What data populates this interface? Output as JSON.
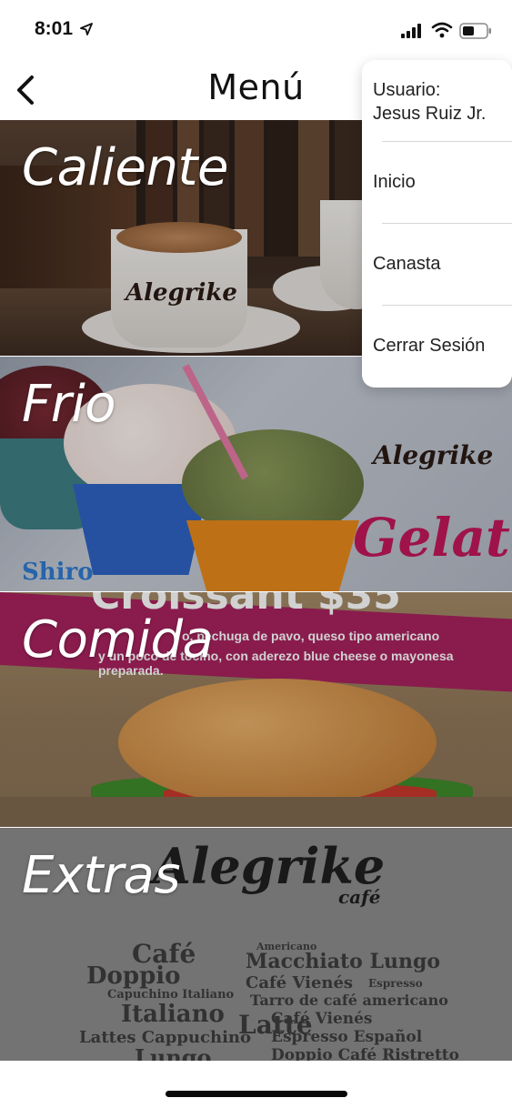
{
  "status_bar": {
    "time": "8:01",
    "icons": [
      "location-arrow-icon",
      "cellular-signal-icon",
      "wifi-icon",
      "battery-icon"
    ]
  },
  "nav": {
    "title": "Menú",
    "back_icon": "chevron-left-icon"
  },
  "categories": [
    {
      "label": "Caliente"
    },
    {
      "label": "Frio"
    },
    {
      "label": "Comida"
    },
    {
      "label": "Extras"
    }
  ],
  "image_text": {
    "brand": "Alegrike",
    "brand_sub": "café",
    "gelato": "Gelato",
    "shiro": "Shiro",
    "croissant": "Croissant $35",
    "croissant_desc_1": "o, pechuga de pavo, queso tipo americano",
    "croissant_desc_2": "y un poco de tocino, con aderezo blue cheese o mayonesa preparada.",
    "extras_words": [
      "Café",
      "Doppio",
      "Capuchino Italiano",
      "Italiano",
      "Lattes Cappuchino",
      "Lungo",
      "Espresso",
      "Macchiato Lungo",
      "Café Vienés",
      "Tarro de café americano",
      "Espresso Español",
      "Doppio Café Ristretto",
      "Latte",
      "Americano"
    ]
  },
  "dropdown": {
    "user_label": "Usuario:",
    "user_name": "Jesus Ruiz Jr.",
    "items": [
      {
        "label": "Inicio"
      },
      {
        "label": "Canasta"
      },
      {
        "label": "Cerrar Sesión"
      }
    ]
  },
  "colors": {
    "background": "#ffffff",
    "text": "#111111",
    "card_label": "#ffffff",
    "gelato_pink": "#c2185b",
    "separator": "#d6d6d6"
  }
}
